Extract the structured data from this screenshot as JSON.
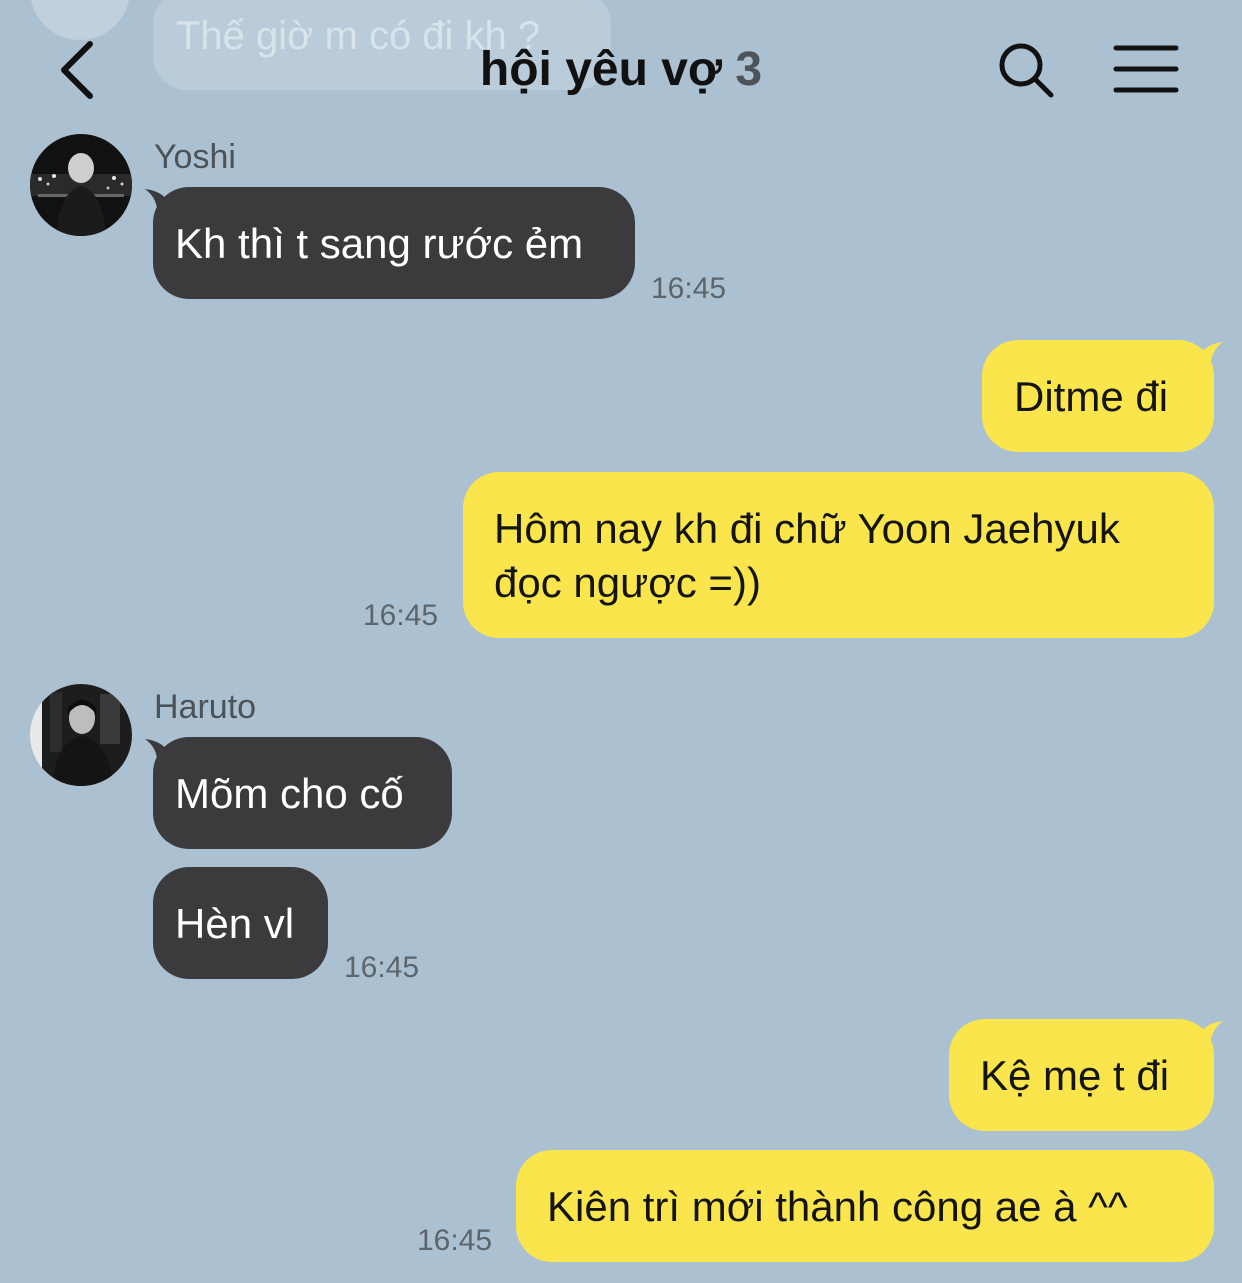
{
  "header": {
    "title": "hội yêu vợ",
    "member_count": "3",
    "back_icon": "chevron-left-icon",
    "search_icon": "search-icon",
    "menu_icon": "hamburger-menu-icon"
  },
  "faded_message": {
    "text": "Thế giờ m có đi kh ?"
  },
  "messages": [
    {
      "sender": "Yoshi",
      "text": "Kh thì t sang rước ẻm",
      "time": "16:45"
    },
    {
      "text": "Ditme đi"
    },
    {
      "text_line1": "Hôm nay kh đi chữ Yoon Jaehyuk",
      "text_line2": "đọc ngược =))",
      "time": "16:45"
    },
    {
      "sender": "Haruto",
      "text": "Mõm cho cố"
    },
    {
      "text": "Hèn vl",
      "time": "16:45"
    },
    {
      "text": "Kệ mẹ t đi"
    },
    {
      "text": "Kiên trì mới thành công ae à ^^",
      "time": "16:45"
    }
  ],
  "colors": {
    "background": "#abc1d1",
    "incoming_bubble": "#3b3b3e",
    "outgoing_bubble": "#fae64c"
  }
}
